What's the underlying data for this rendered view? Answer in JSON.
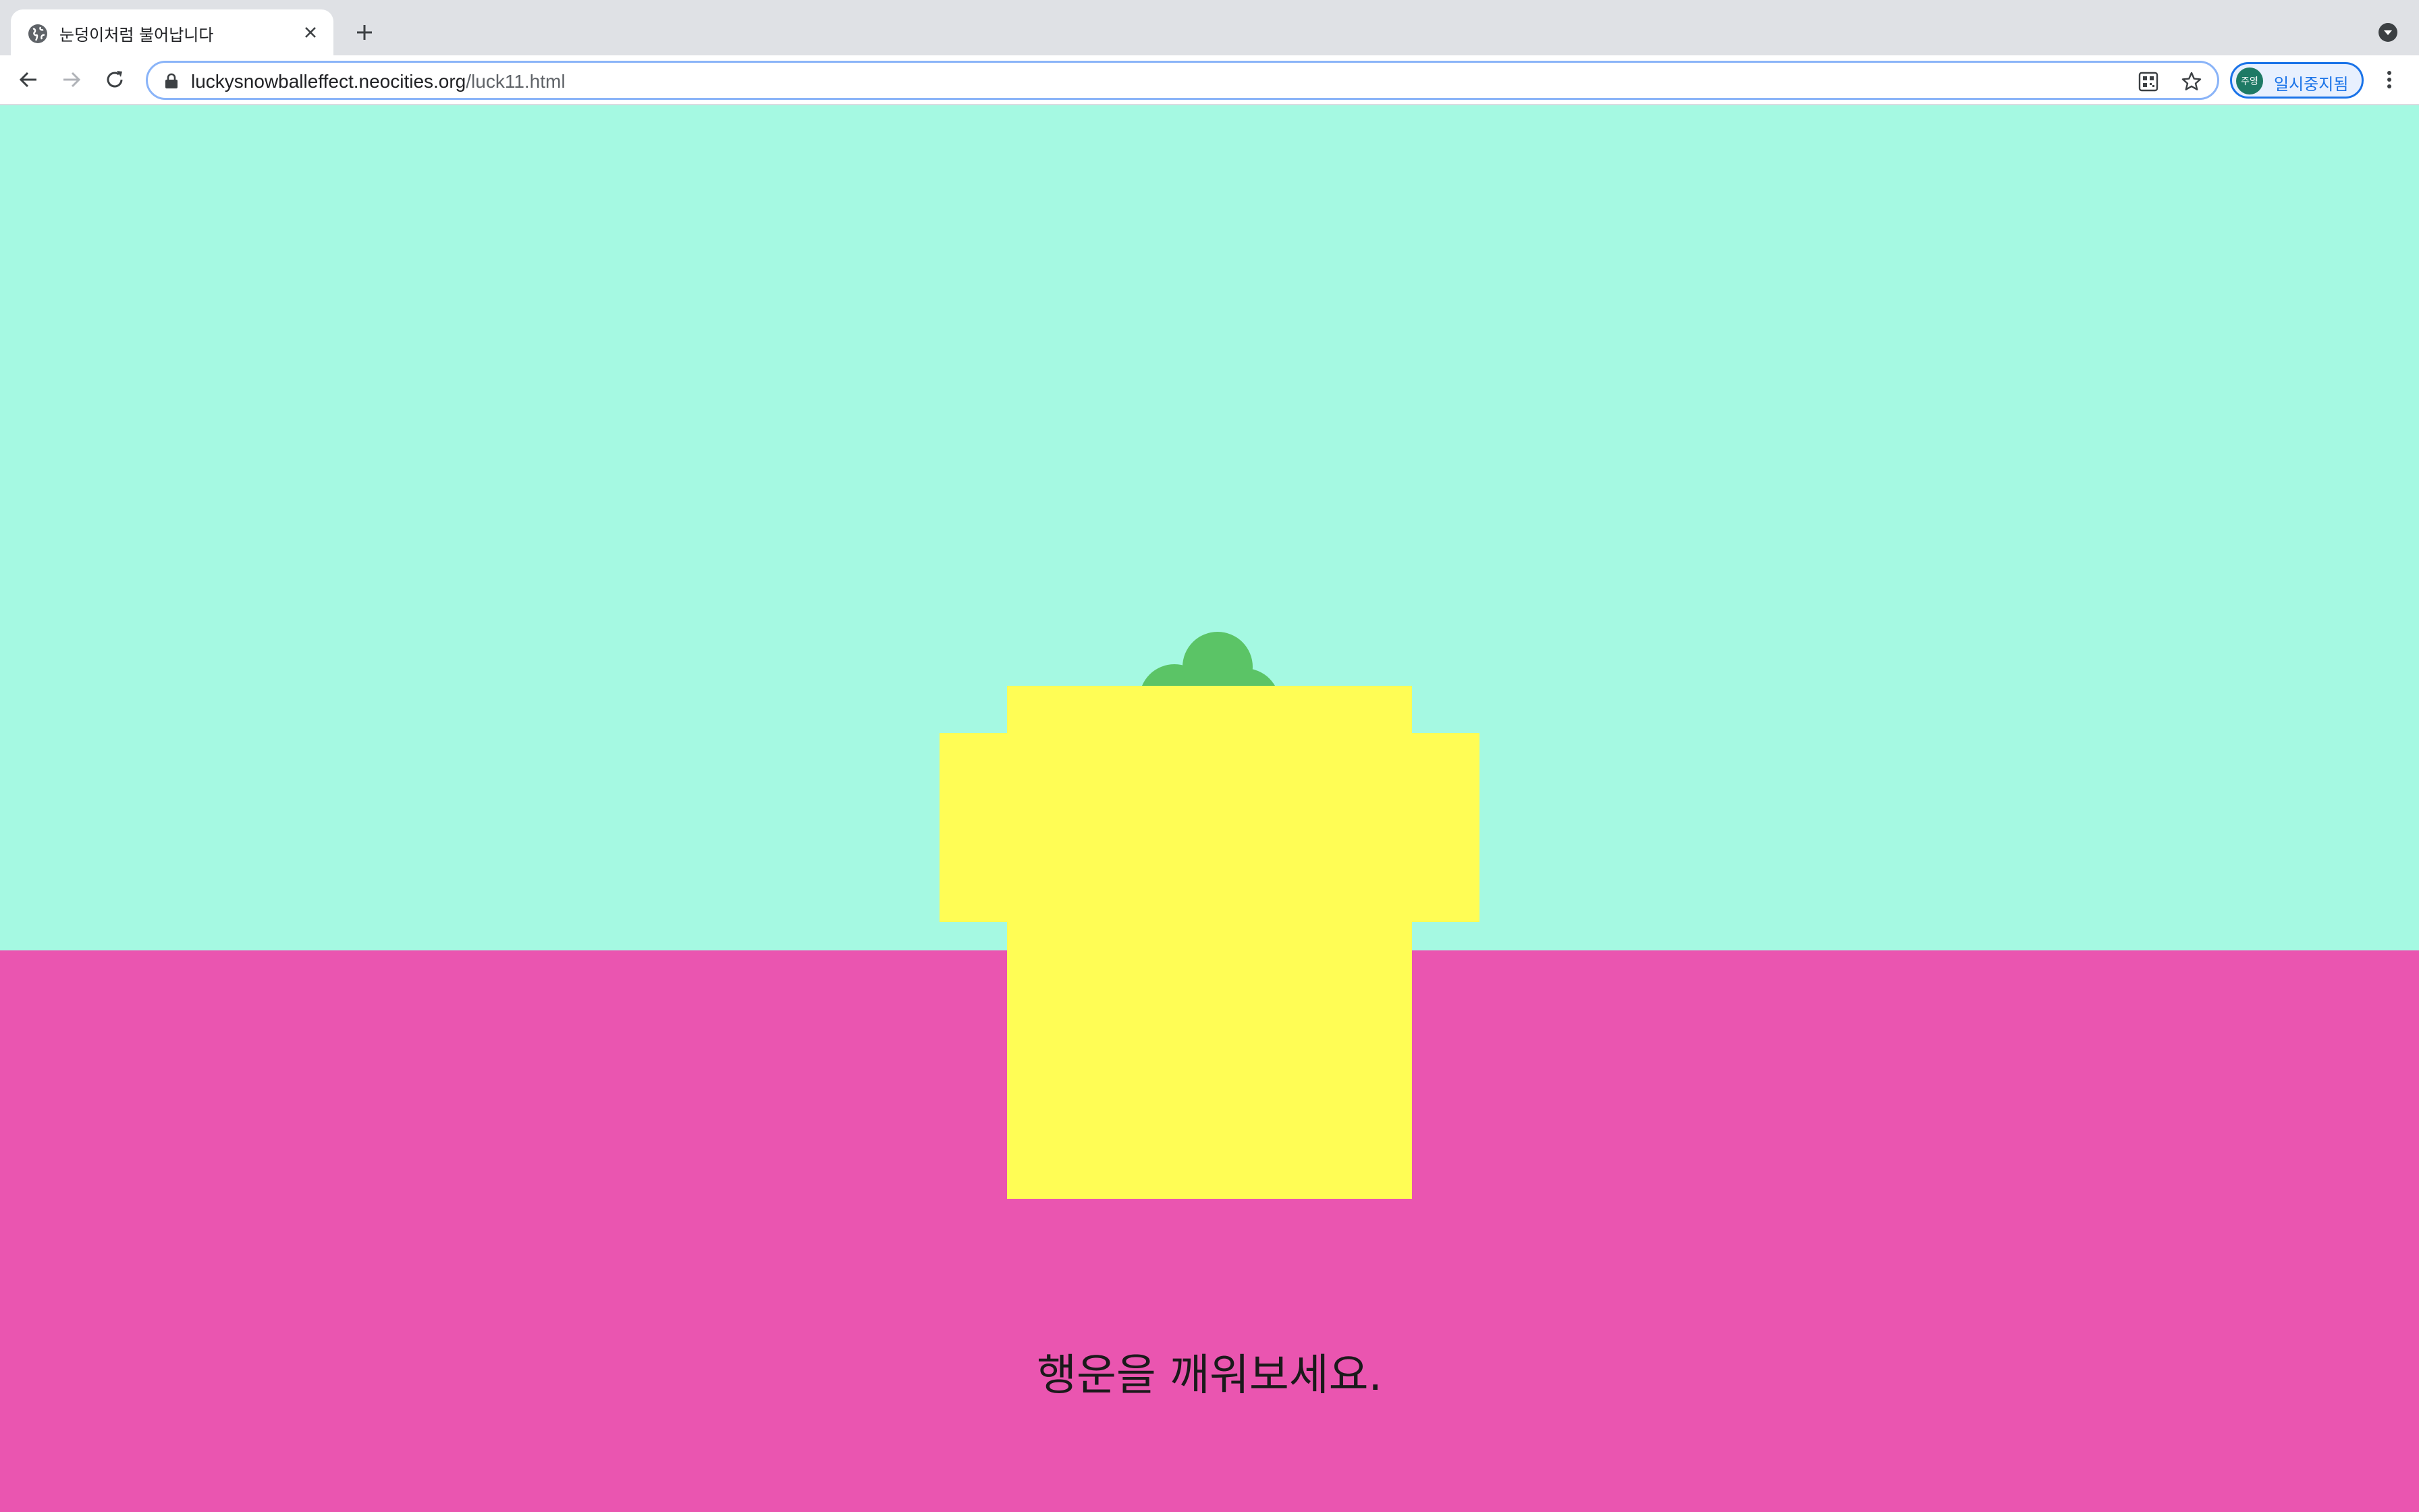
{
  "browser": {
    "tab_title": "눈덩이처럼 불어납니다",
    "url_host": "luckysnowballeffect.neocities.org",
    "url_path": "/luck11.html",
    "profile_avatar_text": "주영",
    "profile_label": "일시중지됨",
    "icons": {
      "favicon": "globe-icon",
      "tab_close": "close-icon",
      "new_tab": "plus-icon",
      "tab_search": "chevron-down-icon",
      "back": "arrow-left-icon",
      "forward": "arrow-right-icon",
      "reload": "reload-icon",
      "lock": "lock-icon",
      "qr": "qr-code-icon",
      "bookmark": "star-icon",
      "menu": "kebab-menu-icon"
    }
  },
  "page": {
    "caption": "행운을 깨워보세요.",
    "colors": {
      "sky": "#a5f9e2",
      "ground": "#ea55b0",
      "block": "#fffd55",
      "clover": "#5bc466"
    }
  }
}
